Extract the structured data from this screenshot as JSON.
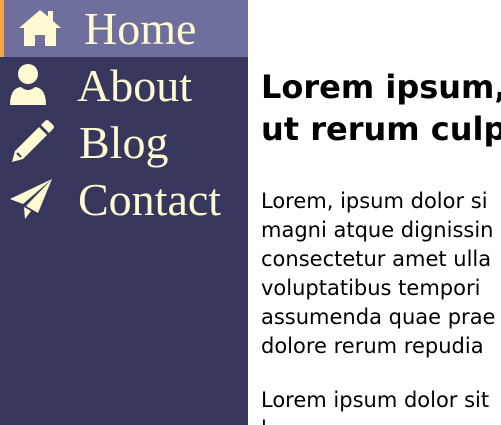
{
  "nav": {
    "items": [
      {
        "label": "Home",
        "icon": "home-icon",
        "active": true
      },
      {
        "label": "About",
        "icon": "user-icon",
        "active": false
      },
      {
        "label": "Blog",
        "icon": "pencil-icon",
        "active": false
      },
      {
        "label": "Contact",
        "icon": "paper-plane-icon",
        "active": false
      }
    ]
  },
  "article": {
    "title_lines": [
      "Lorem ipsum,",
      "ut rerum culp"
    ],
    "paragraph1_lines": [
      "Lorem, ipsum dolor si",
      "magni atque dignissin",
      "consectetur amet ulla",
      "voluptatibus tempori",
      "assumenda quae prae",
      "dolore rerum repudia"
    ],
    "paragraph2_lines": [
      "Lorem ipsum dolor sit",
      "l                     "
    ]
  },
  "colors": {
    "sidebar_bg": "#37375e",
    "active_bg": "#6f6f9e",
    "active_accent": "#f4a64a",
    "nav_text": "#fffad2"
  }
}
